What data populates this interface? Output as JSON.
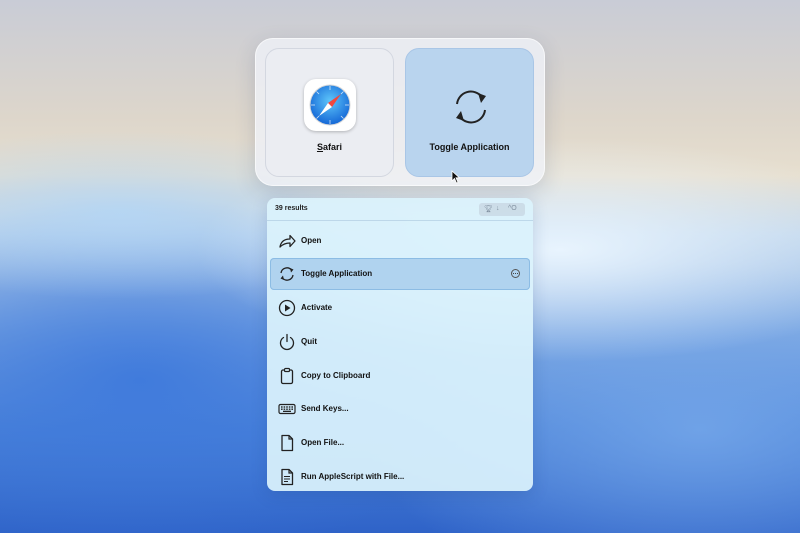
{
  "cards": [
    {
      "label_prefix": "",
      "label_underlined": "S",
      "label_rest": "afari",
      "icon": "safari-icon",
      "selected": false
    },
    {
      "label": "Toggle Application",
      "icon": "toggle-icon",
      "selected": true
    }
  ],
  "results": {
    "count_text": "39 results",
    "sort_icons": [
      "trophy-icon",
      "arrow-down-icon",
      "ctrl-o-shortcut"
    ],
    "sort_shortcut_text": "^O",
    "items": [
      {
        "label": "Open",
        "icon": "share-arrow-icon",
        "selected": false
      },
      {
        "label": "Toggle Application",
        "icon": "toggle-icon",
        "selected": true
      },
      {
        "label": "Activate",
        "icon": "play-circle-icon",
        "selected": false
      },
      {
        "label": "Quit",
        "icon": "power-icon",
        "selected": false
      },
      {
        "label": "Copy to Clipboard",
        "icon": "clipboard-icon",
        "selected": false
      },
      {
        "label": "Send Keys...",
        "icon": "keyboard-icon",
        "selected": false
      },
      {
        "label": "Open File...",
        "icon": "document-icon",
        "selected": false
      },
      {
        "label": "Run AppleScript with File...",
        "icon": "script-document-icon",
        "selected": false
      }
    ]
  },
  "colors": {
    "selected_row": "#b0d3ef",
    "selected_card": "#b9d4ee",
    "panel": "#daf2fc"
  }
}
